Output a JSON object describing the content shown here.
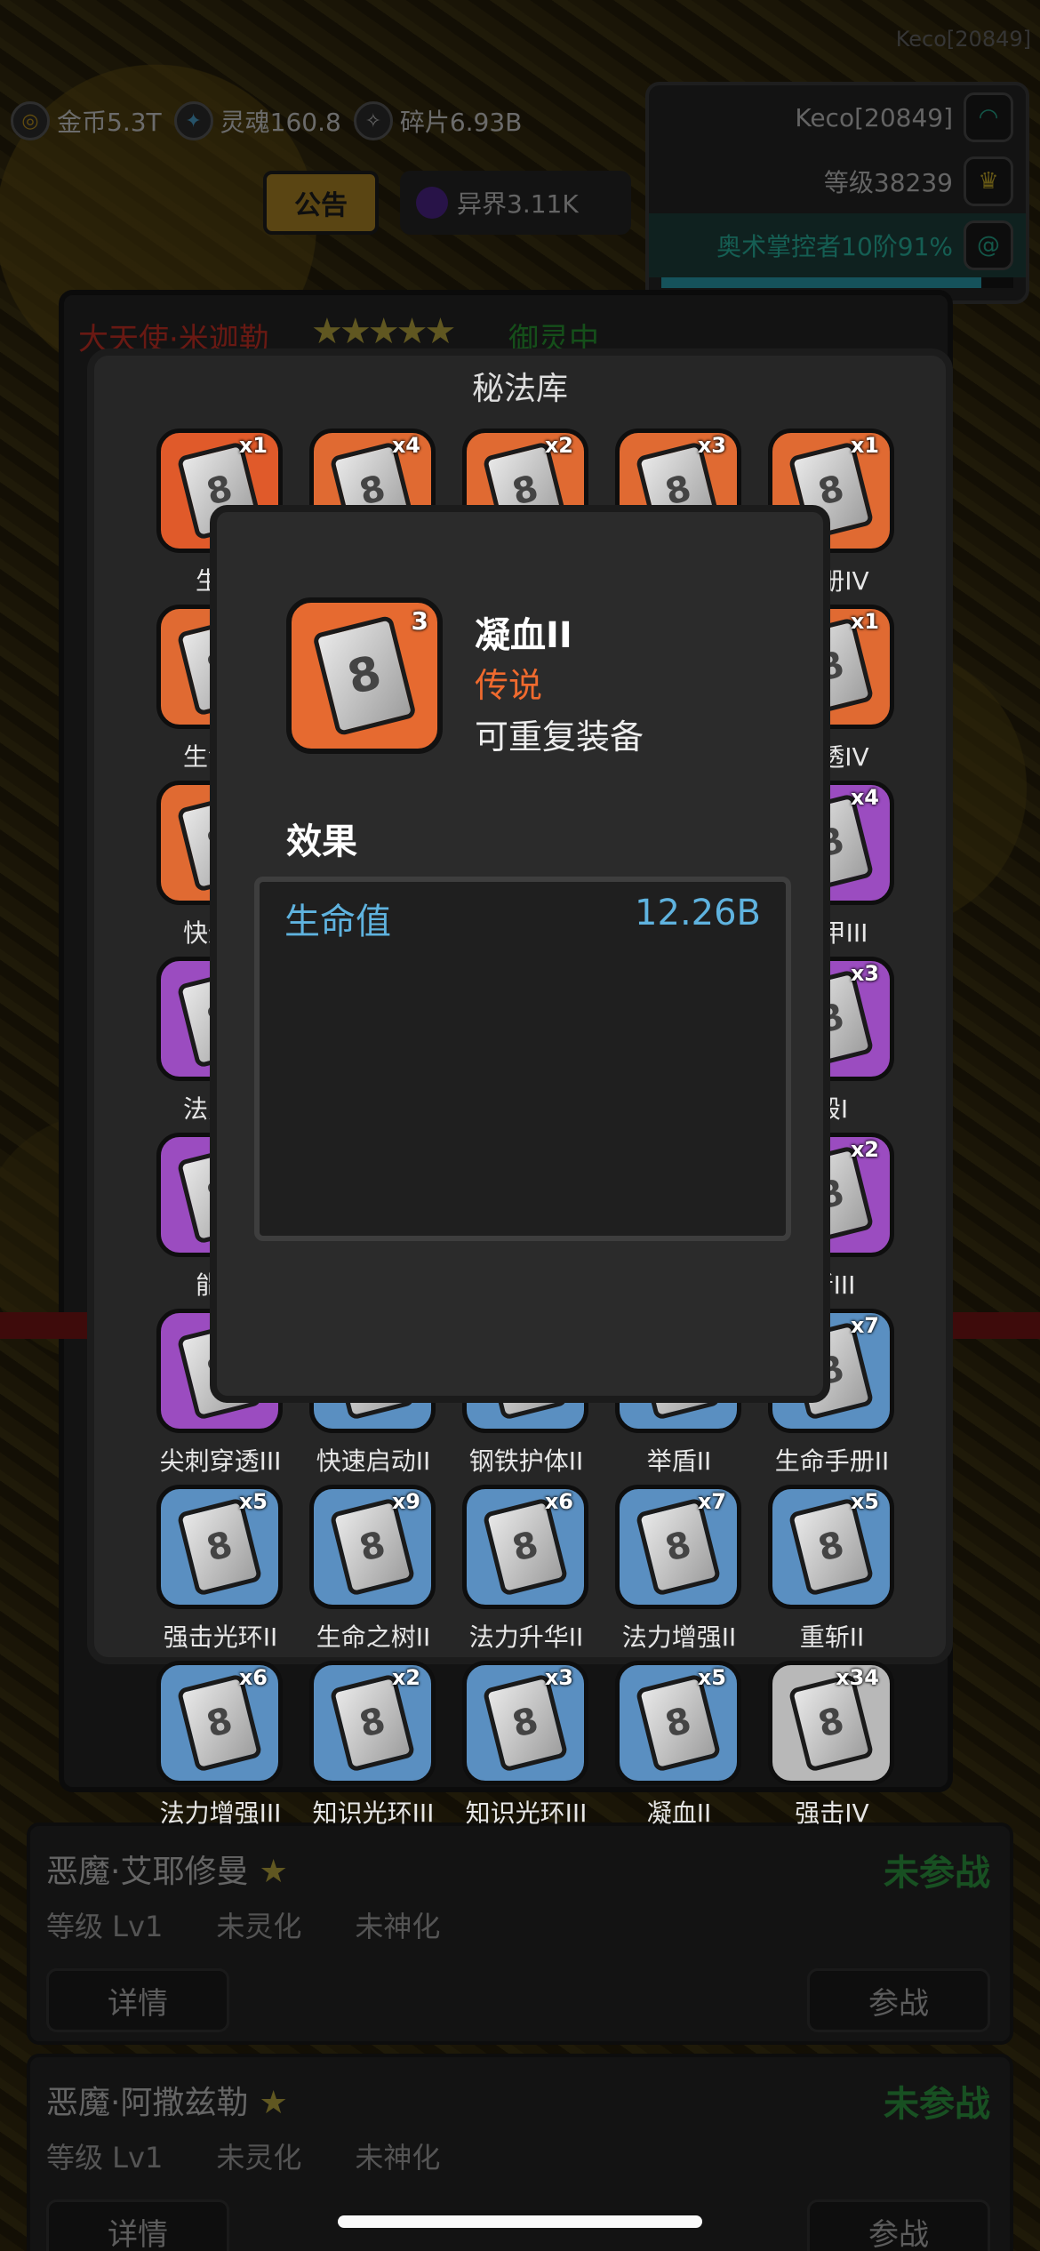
{
  "hud": {
    "player_id_ghost": "Keco[20849]",
    "gold": "金币5.3T",
    "soul": "灵魂160.8",
    "fragments": "碎片6.93B",
    "notice": "公告",
    "otherworld": "异界3.11K",
    "player_name": "Keco[20849]",
    "level": "等级38239",
    "title": "奥术掌控者10阶91%",
    "xp_fraction": 0.91
  },
  "hero": {
    "name": "大天使·米迦勒",
    "stars": "★★★★★",
    "status": "御灵中"
  },
  "arcane": {
    "title": "秘法库",
    "items": [
      {
        "name": "生命",
        "count": "x1",
        "color": "red"
      },
      {
        "name": "",
        "count": "x4",
        "color": "orange"
      },
      {
        "name": "",
        "count": "x2",
        "color": "orange"
      },
      {
        "name": "",
        "count": "x3",
        "color": "orange"
      },
      {
        "name": "手册IV",
        "count": "x1",
        "color": "orange"
      },
      {
        "name": "生命之",
        "count": "",
        "color": "orange"
      },
      {
        "name": "",
        "count": "",
        "color": "orange"
      },
      {
        "name": "",
        "count": "",
        "color": "orange"
      },
      {
        "name": "",
        "count": "",
        "color": "orange"
      },
      {
        "name": "穿透IV",
        "count": "x1",
        "color": "orange"
      },
      {
        "name": "快速启",
        "count": "",
        "color": "orange"
      },
      {
        "name": "",
        "count": "",
        "color": "purple"
      },
      {
        "name": "",
        "count": "",
        "color": "purple"
      },
      {
        "name": "",
        "count": "",
        "color": "purple"
      },
      {
        "name": "战甲III",
        "count": "x4",
        "color": "purple"
      },
      {
        "name": "法力增",
        "count": "",
        "color": "purple"
      },
      {
        "name": "",
        "count": "",
        "color": "purple"
      },
      {
        "name": "",
        "count": "",
        "color": "purple"
      },
      {
        "name": "",
        "count": "",
        "color": "purple"
      },
      {
        "name": "毁I",
        "count": "x3",
        "color": "purple"
      },
      {
        "name": "能量",
        "count": "",
        "color": "purple"
      },
      {
        "name": "",
        "count": "",
        "color": "purple"
      },
      {
        "name": "",
        "count": "",
        "color": "purple"
      },
      {
        "name": "",
        "count": "",
        "color": "purple"
      },
      {
        "name": "斩III",
        "count": "x2",
        "color": "purple"
      },
      {
        "name": "尖刺穿透III",
        "count": "",
        "color": "purple"
      },
      {
        "name": "快速启动II",
        "count": "",
        "color": "blue"
      },
      {
        "name": "钢铁护体II",
        "count": "",
        "color": "blue"
      },
      {
        "name": "举盾II",
        "count": "",
        "color": "blue"
      },
      {
        "name": "生命手册II",
        "count": "x7",
        "color": "blue"
      },
      {
        "name": "强击光环II",
        "count": "x5",
        "color": "blue"
      },
      {
        "name": "生命之树II",
        "count": "x9",
        "color": "blue"
      },
      {
        "name": "法力升华II",
        "count": "x6",
        "color": "blue"
      },
      {
        "name": "法力增强II",
        "count": "x7",
        "color": "blue"
      },
      {
        "name": "重斩II",
        "count": "x5",
        "color": "blue"
      },
      {
        "name": "法力增强III",
        "count": "x6",
        "color": "blue"
      },
      {
        "name": "知识光环III",
        "count": "x2",
        "color": "blue"
      },
      {
        "name": "知识光环III",
        "count": "x3",
        "color": "blue"
      },
      {
        "name": "凝血II",
        "count": "x5",
        "color": "blue"
      },
      {
        "name": "强击IV",
        "count": "x34",
        "color": "white"
      }
    ]
  },
  "popup": {
    "name": "凝血II",
    "count": "3",
    "rarity": "传说",
    "repeat": "可重复装备",
    "effect_title": "效果",
    "effects": [
      {
        "label": "生命值",
        "value": "12.26B"
      }
    ]
  },
  "hero_cards": [
    {
      "name": "恶魔·艾耶修曼",
      "star": "★",
      "status": "未参战",
      "level": "等级 Lv1",
      "spirit": "未灵化",
      "divine": "未神化",
      "detail_btn": "详情",
      "join_btn": "参战"
    },
    {
      "name": "恶魔·阿撒兹勒",
      "star": "★",
      "status": "未参战",
      "level": "等级 Lv1",
      "spirit": "未灵化",
      "divine": "未神化",
      "detail_btn": "详情",
      "join_btn": "参战"
    }
  ],
  "colors": {
    "legendary": "#ef6a2e",
    "effect_text": "#5fb3df",
    "status_green": "#37b24d"
  }
}
